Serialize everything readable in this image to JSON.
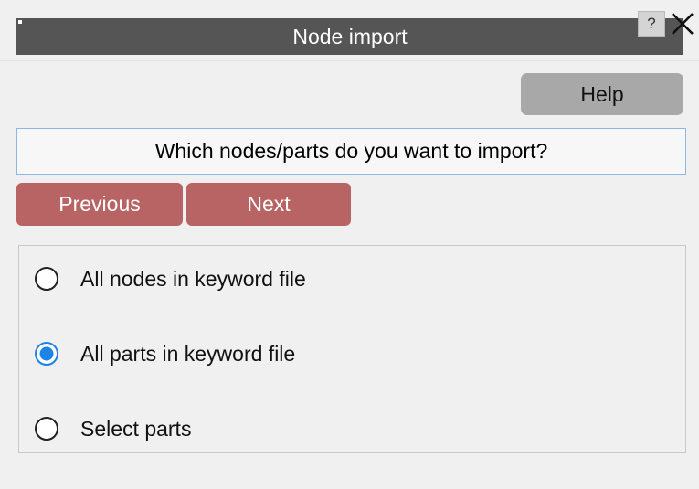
{
  "window": {
    "title": "Node import",
    "help_glyph": "?",
    "close_icon": "close-icon"
  },
  "toolbar": {
    "help_label": "Help"
  },
  "prompt": {
    "question": "Which nodes/parts do you want to import?"
  },
  "navigation": {
    "previous_label": "Previous",
    "next_label": "Next"
  },
  "options": {
    "items": [
      {
        "label": "All nodes in keyword file",
        "selected": false
      },
      {
        "label": "All parts in keyword file",
        "selected": true
      },
      {
        "label": "Select parts",
        "selected": false
      }
    ]
  },
  "colors": {
    "title_bar": "#555555",
    "nav_buttons": "#b86464",
    "help_button": "#a8a8a8",
    "radio_selected": "#1e84e4",
    "question_border": "#8fb6e6"
  }
}
